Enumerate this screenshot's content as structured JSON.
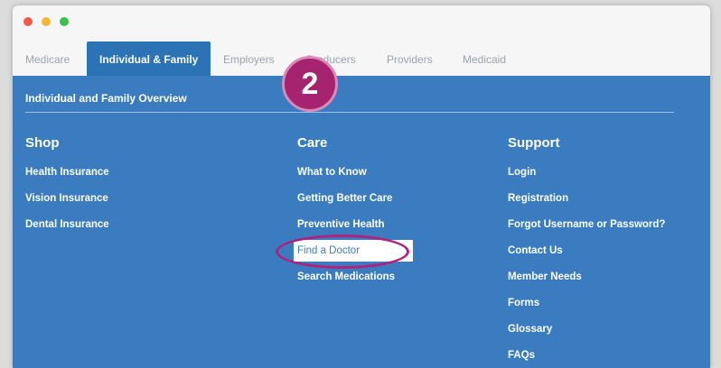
{
  "window": {
    "controls": {
      "close_color": "#ef5a4c",
      "minimize_color": "#f3b833",
      "maximize_color": "#3cbf4e"
    }
  },
  "nav": {
    "tabs": [
      {
        "label": "Medicare"
      },
      {
        "label": "Individual & Family",
        "active": true
      },
      {
        "label": "Employers"
      },
      {
        "label": "Producers"
      },
      {
        "label": "Providers"
      },
      {
        "label": "Medicaid"
      }
    ]
  },
  "panel": {
    "overview_link": "Individual and Family Overview",
    "columns": [
      {
        "title": "Shop",
        "links": [
          "Health Insurance",
          "Vision Insurance",
          "Dental Insurance"
        ]
      },
      {
        "title": "Care",
        "links": [
          "What to Know",
          "Getting Better Care",
          "Preventive Health",
          "Find a Doctor",
          "Search Medications"
        ]
      },
      {
        "title": "Support",
        "links": [
          "Login",
          "Registration",
          "Forgot Username or Password?",
          "Contact Us",
          "Member Needs",
          "Forms",
          "Glossary",
          "FAQs"
        ]
      }
    ]
  },
  "callout": {
    "step_number": "2"
  },
  "colors": {
    "panel_blue": "#3a7cbf",
    "active_tab_blue": "#2b73b5",
    "callout_magenta": "#a6236f"
  }
}
